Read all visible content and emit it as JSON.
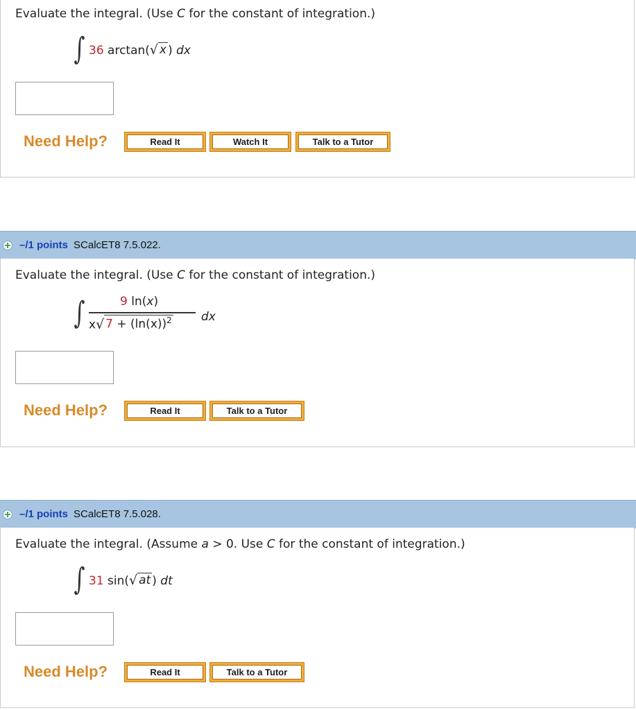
{
  "help_label": "Need Help?",
  "buttons": {
    "read_it": "Read It",
    "watch_it": "Watch It",
    "talk_to_tutor": "Talk to a Tutor"
  },
  "q1": {
    "instruction_prefix": "Evaluate the integral. (Use ",
    "instruction_var": "C",
    "instruction_suffix": " for the constant of integration.)",
    "coef": "36",
    "func": "arctan(",
    "radicand": "x",
    "close": ")",
    "dvar": "dx"
  },
  "q2": {
    "points": "–/1 points",
    "code": "SCalcET8 7.5.022.",
    "instruction_prefix": "Evaluate the integral. (Use ",
    "instruction_var": "C",
    "instruction_suffix": " for the constant of integration.)",
    "num_coef": "9",
    "num_func": "ln(",
    "num_var": "x",
    "num_close": ")",
    "den_x": "x",
    "den_const": "7",
    "den_rest": " + (ln(x))",
    "den_exp": "2",
    "dvar": "dx"
  },
  "q3": {
    "points": "–/1 points",
    "code": "SCalcET8 7.5.028.",
    "instruction_prefix": "Evaluate the integral. (Assume ",
    "instruction_a": "a",
    "instruction_mid": " > 0. Use ",
    "instruction_var": "C",
    "instruction_suffix": " for the constant of integration.)",
    "coef": "31",
    "func": "sin(",
    "radicand": "at",
    "close": ")",
    "dvar": "dt"
  }
}
